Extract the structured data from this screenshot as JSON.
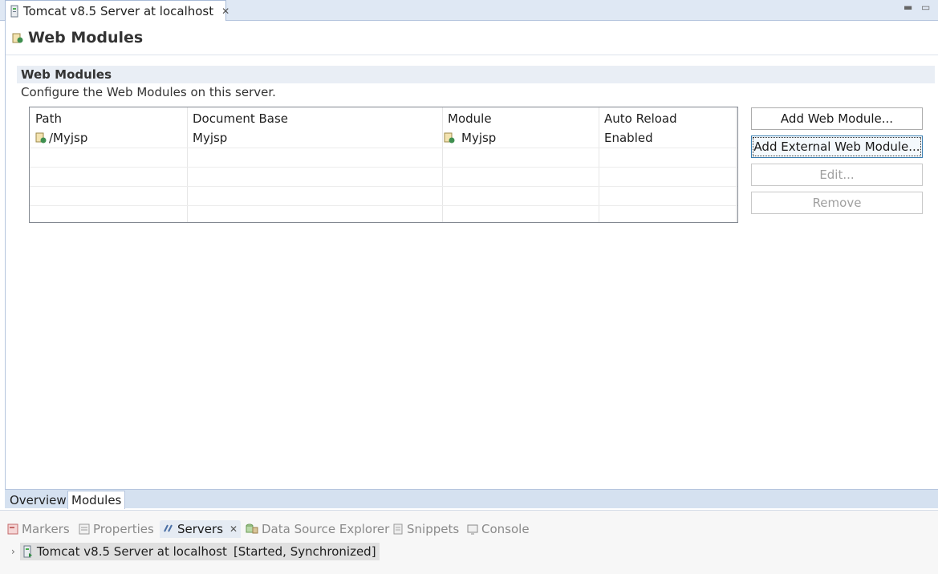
{
  "editor_tab": {
    "title": "Tomcat v8.5 Server at localhost"
  },
  "page": {
    "title": "Web Modules"
  },
  "section": {
    "title": "Web Modules",
    "description": "Configure the Web Modules on this server."
  },
  "table": {
    "columns": [
      "Path",
      "Document Base",
      "Module",
      "Auto Reload"
    ],
    "rows": [
      {
        "path": "/Myjsp",
        "document_base": "Myjsp",
        "module": "Myjsp",
        "auto_reload": "Enabled"
      }
    ]
  },
  "buttons": {
    "add_web_module": "Add Web Module...",
    "add_external_web_module": "Add External Web Module...",
    "edit": "Edit...",
    "remove": "Remove"
  },
  "editor_pages": {
    "overview": "Overview",
    "modules": "Modules"
  },
  "views": {
    "markers": "Markers",
    "properties": "Properties",
    "servers": "Servers",
    "data_source_explorer": "Data Source Explorer",
    "snippets": "Snippets",
    "console": "Console"
  },
  "servers_tree": {
    "server_name": "Tomcat v8.5 Server at localhost",
    "status": "[Started, Synchronized]"
  }
}
